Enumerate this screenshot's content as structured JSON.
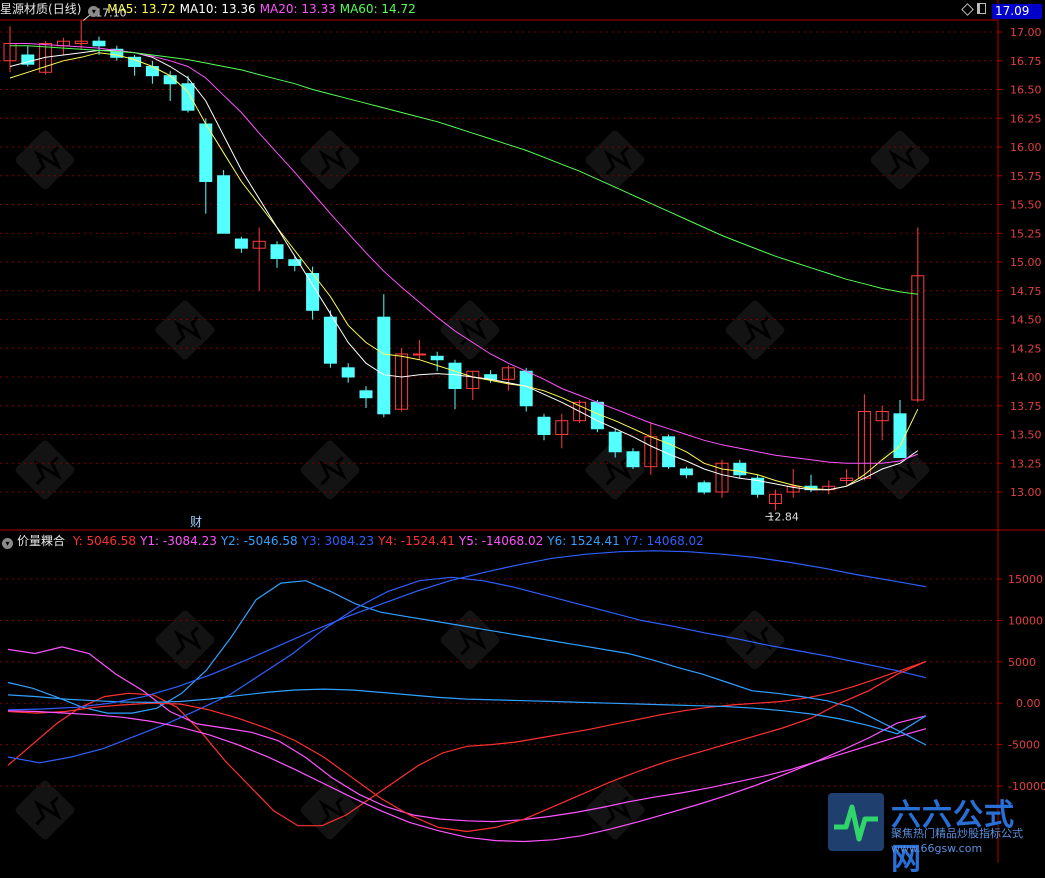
{
  "top_panel": {
    "title": "星源材质",
    "period": "(日线)",
    "ma": [
      {
        "label": "MA5: 13.72",
        "color": "#ffff54"
      },
      {
        "label": "MA10: 13.36",
        "color": "#ffffff"
      },
      {
        "label": "MA20: 13.33",
        "color": "#ff54ff"
      },
      {
        "label": "MA60: 14.72",
        "color": "#54ff54"
      }
    ],
    "current_price": "17.09",
    "high_label": "17.10",
    "low_label": "12.84",
    "event_marker": "财"
  },
  "bottom_panel": {
    "title": "价量粿合",
    "values": [
      {
        "label": "Y: 5046.58",
        "color": "#ff3030"
      },
      {
        "label": "Y1: -3084.23",
        "color": "#ff54ff"
      },
      {
        "label": "Y2: -5046.58",
        "color": "#30a0ff"
      },
      {
        "label": "Y3: 3084.23",
        "color": "#3060ff"
      },
      {
        "label": "Y4: -1524.41",
        "color": "#ff3030"
      },
      {
        "label": "Y5: -14068.02",
        "color": "#ff54ff"
      },
      {
        "label": "Y6: 1524.41",
        "color": "#30a0ff"
      },
      {
        "label": "Y7: 14068.02",
        "color": "#3060ff"
      }
    ]
  },
  "watermark": {
    "brand": "六六公式网",
    "slogan": "聚焦热门精品炒股指标公式",
    "url": "www.66gsw.com"
  },
  "chart_data": [
    {
      "type": "candlestick",
      "title": "星源材质 (日线)",
      "ylim": [
        12.7,
        17.15
      ],
      "yticks": [
        13.0,
        13.25,
        13.5,
        13.75,
        14.0,
        14.25,
        14.5,
        14.75,
        15.0,
        15.25,
        15.5,
        15.75,
        16.0,
        16.25,
        16.5,
        16.75,
        17.0
      ],
      "grid": true,
      "candles": [
        {
          "o": 16.75,
          "h": 17.05,
          "l": 16.65,
          "c": 16.9
        },
        {
          "o": 16.8,
          "h": 16.88,
          "l": 16.7,
          "c": 16.72
        },
        {
          "o": 16.65,
          "h": 16.92,
          "l": 16.63,
          "c": 16.9
        },
        {
          "o": 16.88,
          "h": 16.95,
          "l": 16.8,
          "c": 16.92
        },
        {
          "o": 16.9,
          "h": 17.1,
          "l": 16.85,
          "c": 16.92
        },
        {
          "o": 16.92,
          "h": 16.96,
          "l": 16.8,
          "c": 16.88
        },
        {
          "o": 16.85,
          "h": 16.88,
          "l": 16.75,
          "c": 16.78
        },
        {
          "o": 16.78,
          "h": 16.8,
          "l": 16.62,
          "c": 16.7
        },
        {
          "o": 16.7,
          "h": 16.75,
          "l": 16.55,
          "c": 16.62
        },
        {
          "o": 16.62,
          "h": 16.66,
          "l": 16.4,
          "c": 16.55
        },
        {
          "o": 16.55,
          "h": 16.62,
          "l": 16.3,
          "c": 16.32
        },
        {
          "o": 16.2,
          "h": 16.25,
          "l": 15.42,
          "c": 15.7
        },
        {
          "o": 15.75,
          "h": 15.8,
          "l": 15.4,
          "c": 15.25
        },
        {
          "o": 15.2,
          "h": 15.22,
          "l": 15.08,
          "c": 15.12
        },
        {
          "o": 15.12,
          "h": 15.3,
          "l": 14.75,
          "c": 15.18
        },
        {
          "o": 15.15,
          "h": 15.18,
          "l": 14.95,
          "c": 15.03
        },
        {
          "o": 15.02,
          "h": 15.05,
          "l": 14.92,
          "c": 14.97
        },
        {
          "o": 14.9,
          "h": 14.96,
          "l": 14.5,
          "c": 14.58
        },
        {
          "o": 14.52,
          "h": 14.58,
          "l": 14.08,
          "c": 14.12
        },
        {
          "o": 14.08,
          "h": 14.12,
          "l": 13.95,
          "c": 14.0
        },
        {
          "o": 13.88,
          "h": 13.92,
          "l": 13.73,
          "c": 13.82
        },
        {
          "o": 14.52,
          "h": 14.72,
          "l": 13.65,
          "c": 13.68
        },
        {
          "o": 13.72,
          "h": 14.25,
          "l": 13.7,
          "c": 14.2
        },
        {
          "o": 14.2,
          "h": 14.32,
          "l": 14.15,
          "c": 14.2
        },
        {
          "o": 14.18,
          "h": 14.22,
          "l": 14.05,
          "c": 14.15
        },
        {
          "o": 14.12,
          "h": 14.15,
          "l": 13.72,
          "c": 13.9
        },
        {
          "o": 13.9,
          "h": 14.05,
          "l": 13.8,
          "c": 14.05
        },
        {
          "o": 14.02,
          "h": 14.06,
          "l": 13.95,
          "c": 13.98
        },
        {
          "o": 13.98,
          "h": 14.1,
          "l": 13.88,
          "c": 14.08
        },
        {
          "o": 14.05,
          "h": 14.08,
          "l": 13.7,
          "c": 13.75
        },
        {
          "o": 13.65,
          "h": 13.68,
          "l": 13.45,
          "c": 13.5
        },
        {
          "o": 13.5,
          "h": 13.68,
          "l": 13.38,
          "c": 13.62
        },
        {
          "o": 13.62,
          "h": 13.8,
          "l": 13.6,
          "c": 13.78
        },
        {
          "o": 13.78,
          "h": 13.8,
          "l": 13.52,
          "c": 13.55
        },
        {
          "o": 13.52,
          "h": 13.55,
          "l": 13.3,
          "c": 13.35
        },
        {
          "o": 13.35,
          "h": 13.38,
          "l": 13.2,
          "c": 13.22
        },
        {
          "o": 13.22,
          "h": 13.6,
          "l": 13.15,
          "c": 13.48
        },
        {
          "o": 13.48,
          "h": 13.5,
          "l": 13.2,
          "c": 13.22
        },
        {
          "o": 13.2,
          "h": 13.22,
          "l": 13.12,
          "c": 13.15
        },
        {
          "o": 13.08,
          "h": 13.1,
          "l": 12.98,
          "c": 13.0
        },
        {
          "o": 13.0,
          "h": 13.28,
          "l": 12.95,
          "c": 13.25
        },
        {
          "o": 13.25,
          "h": 13.28,
          "l": 13.12,
          "c": 13.15
        },
        {
          "o": 13.12,
          "h": 13.15,
          "l": 12.95,
          "c": 12.98
        },
        {
          "o": 12.9,
          "h": 13.02,
          "l": 12.84,
          "c": 12.98
        },
        {
          "o": 13.0,
          "h": 13.2,
          "l": 12.95,
          "c": 13.05
        },
        {
          "o": 13.05,
          "h": 13.15,
          "l": 13.0,
          "c": 13.02
        },
        {
          "o": 13.02,
          "h": 13.1,
          "l": 12.98,
          "c": 13.05
        },
        {
          "o": 13.1,
          "h": 13.2,
          "l": 13.05,
          "c": 13.12
        },
        {
          "o": 13.12,
          "h": 13.85,
          "l": 13.1,
          "c": 13.7
        },
        {
          "o": 13.62,
          "h": 13.75,
          "l": 13.45,
          "c": 13.7
        },
        {
          "o": 13.68,
          "h": 13.8,
          "l": 13.55,
          "c": 13.3
        },
        {
          "o": 13.8,
          "h": 15.3,
          "l": 13.78,
          "c": 14.88
        }
      ],
      "ma_lines": [
        {
          "name": "MA5",
          "color": "#ffff54",
          "values": [
            16.6,
            16.65,
            16.7,
            16.75,
            16.78,
            16.82,
            16.8,
            16.76,
            16.7,
            16.62,
            16.48,
            16.2,
            15.95,
            15.7,
            15.5,
            15.3,
            15.1,
            14.9,
            14.7,
            14.45,
            14.3,
            14.2,
            14.18,
            14.15,
            14.1,
            14.05,
            14.0,
            13.97,
            13.94,
            13.92,
            13.88,
            13.82,
            13.75,
            13.68,
            13.62,
            13.55,
            13.48,
            13.42,
            13.35,
            13.25,
            13.2,
            13.18,
            13.15,
            13.1,
            13.06,
            13.03,
            13.02,
            13.05,
            13.15,
            13.28,
            13.4,
            13.72
          ]
        },
        {
          "name": "MA10",
          "color": "#ffffff",
          "values": [
            16.7,
            16.74,
            16.78,
            16.8,
            16.82,
            16.84,
            16.84,
            16.82,
            16.78,
            16.7,
            16.6,
            16.4,
            16.1,
            15.8,
            15.55,
            15.3,
            15.05,
            14.8,
            14.55,
            14.3,
            14.12,
            14.02,
            14.0,
            14.02,
            14.03,
            14.02,
            14.0,
            13.98,
            13.95,
            13.92,
            13.85,
            13.78,
            13.7,
            13.62,
            13.55,
            13.48,
            13.4,
            13.33,
            13.27,
            13.2,
            13.15,
            13.12,
            13.1,
            13.07,
            13.04,
            13.02,
            13.02,
            13.05,
            13.12,
            13.2,
            13.25,
            13.36
          ]
        },
        {
          "name": "MA20",
          "color": "#ff54ff",
          "values": [
            16.9,
            16.9,
            16.89,
            16.88,
            16.87,
            16.86,
            16.84,
            16.82,
            16.79,
            16.75,
            16.7,
            16.6,
            16.45,
            16.3,
            16.12,
            15.95,
            15.78,
            15.6,
            15.42,
            15.25,
            15.08,
            14.92,
            14.78,
            14.65,
            14.52,
            14.4,
            14.3,
            14.2,
            14.12,
            14.05,
            13.98,
            13.9,
            13.84,
            13.78,
            13.72,
            13.66,
            13.6,
            13.55,
            13.5,
            13.45,
            13.41,
            13.38,
            13.35,
            13.32,
            13.3,
            13.28,
            13.26,
            13.25,
            13.25,
            13.25,
            13.27,
            13.33
          ]
        },
        {
          "name": "MA60",
          "color": "#54ff54",
          "values": [
            16.88,
            16.88,
            16.87,
            16.86,
            16.85,
            16.84,
            16.83,
            16.82,
            16.8,
            16.78,
            16.76,
            16.73,
            16.7,
            16.67,
            16.63,
            16.59,
            16.55,
            16.5,
            16.46,
            16.42,
            16.38,
            16.34,
            16.3,
            16.26,
            16.22,
            16.17,
            16.12,
            16.07,
            16.02,
            15.97,
            15.91,
            15.85,
            15.79,
            15.72,
            15.65,
            15.58,
            15.51,
            15.44,
            15.37,
            15.3,
            15.23,
            15.17,
            15.11,
            15.05,
            15.0,
            14.95,
            14.9,
            14.85,
            14.81,
            14.77,
            14.74,
            14.72
          ]
        }
      ]
    },
    {
      "type": "line",
      "title": "价量粿合",
      "ylim": [
        -18500,
        18500
      ],
      "yticks": [
        -10000,
        -5000,
        0.0,
        5000,
        10000,
        15000
      ],
      "grid": true,
      "series": [
        {
          "name": "Y",
          "color": "#ff3030",
          "values": [
            -7500,
            -5000,
            -2500,
            -500,
            800,
            1200,
            1000,
            -500,
            -3500,
            -7000,
            -10000,
            -13000,
            -14800,
            -14800,
            -13500,
            -11500,
            -9500,
            -7500,
            -6000,
            -5200,
            -5000,
            -4700,
            -4200,
            -3700,
            -3200,
            -2600,
            -2000,
            -1400,
            -900,
            -500,
            -200,
            0,
            200,
            600,
            1200,
            2000,
            3000,
            4000,
            5047
          ]
        },
        {
          "name": "Y1",
          "color": "#ff54ff",
          "values": [
            6500,
            6000,
            6800,
            6000,
            3500,
            1500,
            -1000,
            -2500,
            -3000,
            -3500,
            -4500,
            -6500,
            -9000,
            -11000,
            -12500,
            -13500,
            -14000,
            -14200,
            -14300,
            -14100,
            -13700,
            -13200,
            -12600,
            -11900,
            -11300,
            -10800,
            -10200,
            -9500,
            -8800,
            -8000,
            -7000,
            -6000,
            -5000,
            -4000,
            -3084
          ]
        },
        {
          "name": "Y2",
          "color": "#30a0ff",
          "values": [
            2500,
            1800,
            700,
            -500,
            -1200,
            -1200,
            -600,
            1200,
            4000,
            8000,
            12500,
            14500,
            14800,
            13500,
            12000,
            11000,
            10500,
            10000,
            9500,
            9000,
            8500,
            8000,
            7500,
            7000,
            6500,
            6000,
            5200,
            4300,
            3500,
            2500,
            1500,
            1200,
            800,
            300,
            -500,
            -2000,
            -3500,
            -5047
          ]
        },
        {
          "name": "Y3",
          "color": "#3060ff",
          "values": [
            -6500,
            -7200,
            -6500,
            -5500,
            -4000,
            -2500,
            -800,
            1000,
            3500,
            6000,
            9000,
            11500,
            13500,
            14800,
            15200,
            14800,
            14000,
            13000,
            12000,
            11000,
            10000,
            9300,
            8500,
            7800,
            7000,
            6300,
            5600,
            4800,
            4000,
            3084
          ]
        },
        {
          "name": "Y4",
          "color": "#ff3030",
          "values": [
            -1000,
            -1200,
            -1000,
            -500,
            -200,
            0,
            -100,
            -800,
            -1800,
            -3000,
            -4500,
            -6500,
            -9000,
            -11500,
            -13500,
            -15000,
            -15500,
            -15000,
            -14000,
            -12500,
            -11000,
            -9500,
            -8200,
            -7000,
            -6000,
            -5000,
            -4000,
            -3000,
            -1800,
            0,
            1500,
            3500,
            5046
          ]
        },
        {
          "name": "Y5",
          "color": "#ff54ff",
          "values": [
            -900,
            -1000,
            -1200,
            -1400,
            -1700,
            -2200,
            -2900,
            -3800,
            -5000,
            -6400,
            -8000,
            -9700,
            -11400,
            -13000,
            -14400,
            -15400,
            -16200,
            -16600,
            -16700,
            -16500,
            -16000,
            -15200,
            -14300,
            -13300,
            -12300,
            -11200,
            -10000,
            -8700,
            -7300,
            -5800,
            -4200,
            -2400,
            -1524
          ]
        },
        {
          "name": "Y6",
          "color": "#30a0ff",
          "values": [
            1000,
            800,
            500,
            300,
            150,
            100,
            200,
            500,
            900,
            1300,
            1600,
            1700,
            1600,
            1300,
            1000,
            700,
            500,
            400,
            300,
            200,
            100,
            0,
            -100,
            -200,
            -300,
            -400,
            -600,
            -900,
            -1300,
            -1900,
            -2700,
            -3700,
            -1524
          ]
        },
        {
          "name": "Y7",
          "color": "#3060ff",
          "values": [
            -800,
            -700,
            -500,
            0,
            800,
            2000,
            3500,
            5200,
            7000,
            8800,
            10500,
            12000,
            13500,
            14800,
            15800,
            16700,
            17500,
            18000,
            18300,
            18400,
            18300,
            18000,
            17600,
            17000,
            16300,
            15500,
            14800,
            14068
          ]
        }
      ]
    }
  ]
}
